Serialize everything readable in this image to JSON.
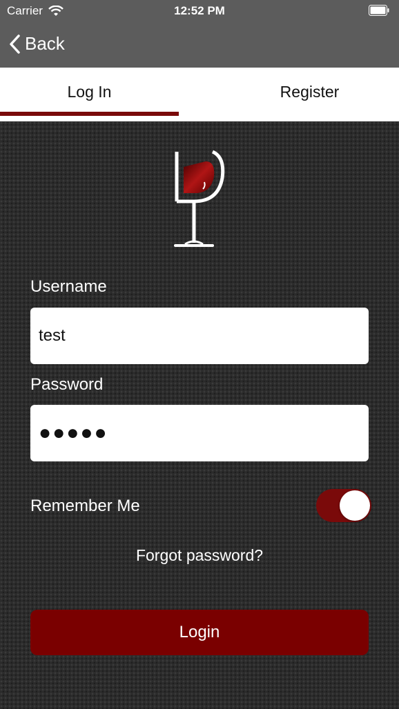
{
  "status_bar": {
    "carrier": "Carrier",
    "time": "12:52 PM",
    "wifi_icon": "wifi-icon",
    "battery_icon": "battery-icon"
  },
  "nav": {
    "back_label": "Back",
    "back_icon": "chevron-left-icon"
  },
  "tabs": [
    {
      "label": "Log In",
      "active": true
    },
    {
      "label": "Register",
      "active": false
    }
  ],
  "logo": {
    "icon": "wine-glass-logo-icon"
  },
  "form": {
    "username_label": "Username",
    "username_value": "test",
    "password_label": "Password",
    "password_masked": "●●●●●",
    "remember_label": "Remember Me",
    "remember_on": true,
    "forgot_label": "Forgot password?",
    "login_label": "Login"
  },
  "colors": {
    "accent": "#7a0a0a",
    "navbar": "#5c5c5c"
  }
}
